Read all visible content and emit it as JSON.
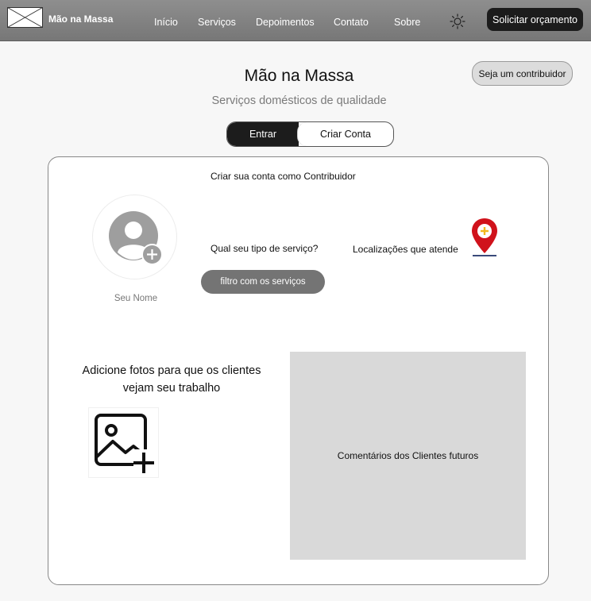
{
  "nav": {
    "brand": "Mão na Massa",
    "links": [
      "Início",
      "Serviços",
      "Depoimentos",
      "Contato",
      "Sobre"
    ],
    "theme_icon": "sun-icon",
    "cta_label": "Solicitar orçamento"
  },
  "header": {
    "contributor_button": "Seja um contribuidor",
    "title": "Mão na Massa",
    "subtitle": "Serviços domésticos de qualidade",
    "tabs": [
      {
        "label": "Entrar",
        "active": true
      },
      {
        "label": "Criar Conta",
        "active": false
      }
    ]
  },
  "form": {
    "title": "Criar sua conta como Contribuidor",
    "avatar_icon": "user-avatar-icon",
    "add_icon": "plus-circle-icon",
    "name_label": "Seu Nome",
    "service_question": "Qual seu tipo de serviço?",
    "service_filter_button": "filtro com os serviços",
    "locations_label": "Localizações que atende",
    "location_icon": "location-pin-add-icon",
    "photos_text": "Adicione fotos para que os clientes vejam seu trabalho",
    "add_photo_icon": "image-add-icon",
    "comments_placeholder": "Comentários dos Clientes futuros"
  },
  "colors": {
    "topbar": "#808080",
    "dark_button": "#1c1c1c",
    "pin_red": "#d0121b",
    "pin_plus": "#f2b91f",
    "comments_bg": "#d9d9d9"
  }
}
